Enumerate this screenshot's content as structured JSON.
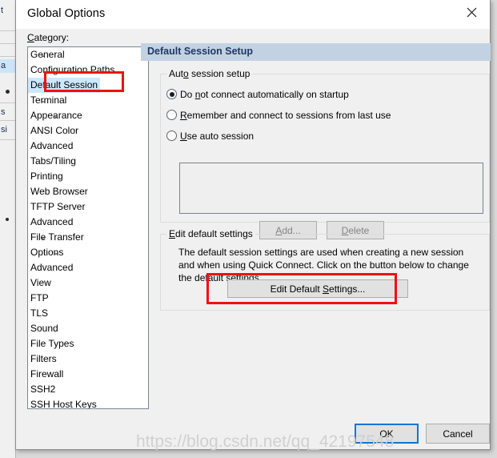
{
  "colors": {
    "accent_header": "#c3d2e3",
    "header_text": "#1f3864",
    "selection": "#cce8ff",
    "annotation_red": "#ee1111",
    "focus_blue": "#0078d7",
    "dialog_bg": "#f0f0f0",
    "desktop_bg": "#d9d9d9"
  },
  "background_window": {
    "fragments": [
      "t",
      "a",
      "s",
      "si"
    ]
  },
  "dialog": {
    "title": "Global Options",
    "close_icon": "close-icon",
    "category_label": "Category:",
    "category_label_accel": "C"
  },
  "tree": {
    "items": [
      {
        "label": "General",
        "depth": 0,
        "chevron": "expanded",
        "selected": false
      },
      {
        "label": "Configuration Paths",
        "depth": 1,
        "chevron": "none",
        "selected": false
      },
      {
        "label": "Default Session",
        "depth": 1,
        "chevron": "none",
        "selected": true
      },
      {
        "label": "Terminal",
        "depth": 0,
        "chevron": "expanded",
        "selected": false
      },
      {
        "label": "Appearance",
        "depth": 1,
        "chevron": "expanded",
        "selected": false
      },
      {
        "label": "ANSI Color",
        "depth": 2,
        "chevron": "none",
        "selected": false
      },
      {
        "label": "Advanced",
        "depth": 2,
        "chevron": "none",
        "selected": false
      },
      {
        "label": "Tabs/Tiling",
        "depth": 1,
        "chevron": "none",
        "selected": false
      },
      {
        "label": "Printing",
        "depth": 1,
        "chevron": "none",
        "selected": false
      },
      {
        "label": "Web Browser",
        "depth": 1,
        "chevron": "none",
        "selected": false
      },
      {
        "label": "TFTP Server",
        "depth": 1,
        "chevron": "none",
        "selected": false
      },
      {
        "label": "Advanced",
        "depth": 1,
        "chevron": "none",
        "selected": false
      },
      {
        "label": "File Transfer",
        "depth": 0,
        "chevron": "expanded",
        "selected": false
      },
      {
        "label": "Options",
        "depth": 1,
        "chevron": "expanded",
        "selected": false
      },
      {
        "label": "Advanced",
        "depth": 2,
        "chevron": "none",
        "selected": false
      },
      {
        "label": "View",
        "depth": 1,
        "chevron": "none",
        "selected": false
      },
      {
        "label": "FTP",
        "depth": 1,
        "chevron": "none",
        "selected": false
      },
      {
        "label": "TLS",
        "depth": 1,
        "chevron": "none",
        "selected": false
      },
      {
        "label": "Sound",
        "depth": 1,
        "chevron": "none",
        "selected": false
      },
      {
        "label": "File Types",
        "depth": 1,
        "chevron": "none",
        "selected": false
      },
      {
        "label": "Filters",
        "depth": 1,
        "chevron": "none",
        "selected": false
      },
      {
        "label": "Firewall",
        "depth": 0,
        "chevron": "none",
        "selected": false
      },
      {
        "label": "SSH2",
        "depth": 0,
        "chevron": "none",
        "selected": false
      },
      {
        "label": "SSH Host Keys",
        "depth": 0,
        "chevron": "none",
        "selected": false
      }
    ]
  },
  "pane": {
    "header": "Default Session Setup",
    "auto_session_group": {
      "title_pre": "Aut",
      "title_accel": "o",
      "title_post": " session setup",
      "radios": [
        {
          "pre": "Do ",
          "accel": "n",
          "post": "ot connect automatically on startup",
          "selected": true
        },
        {
          "pre": "",
          "accel": "R",
          "post": "emember and connect to sessions from last use",
          "selected": false
        },
        {
          "pre": "",
          "accel": "U",
          "post": "se auto session",
          "selected": false
        }
      ],
      "list_items": [],
      "add_button": {
        "pre": "",
        "accel": "A",
        "post": "dd...",
        "enabled": false
      },
      "delete_button": {
        "pre": "",
        "accel": "D",
        "post": "elete",
        "enabled": false
      }
    },
    "edit_default_group": {
      "title_pre": "",
      "title_accel": "E",
      "title_post": "dit default settings",
      "description": "The default session settings are used when creating a new session and when using Quick Connect.  Click on the button below to change the default settings.",
      "button": {
        "pre": "Edit Default ",
        "accel": "S",
        "post": "ettings..."
      }
    }
  },
  "footer": {
    "ok_label": "OK",
    "cancel_label": "Cancel"
  },
  "watermark": {
    "text": "https://blog.csdn.net/qq_42197548"
  }
}
